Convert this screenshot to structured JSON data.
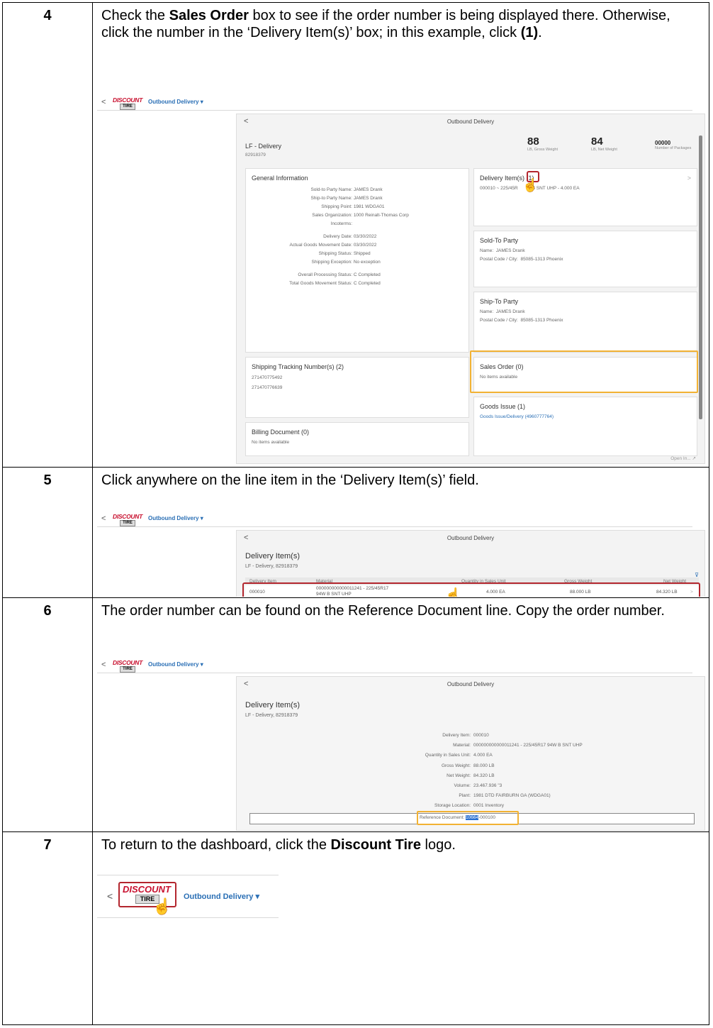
{
  "steps": [
    {
      "number": "4",
      "text_parts": [
        "Check the ",
        "Sales Order",
        " box to see if the order number is being displayed there. Otherwise, click the number in the ‘Delivery Item(s)’ box; in this example, click ",
        "(1)",
        "."
      ]
    },
    {
      "number": "5",
      "text": "Click anywhere on the line item in the ‘Delivery Item(s)’ field."
    },
    {
      "number": "6",
      "text": "The order number can be found on the Reference Document line. Copy the order number."
    },
    {
      "number": "7",
      "text_parts": [
        "To return to the dashboard, click the ",
        "Discount Tire",
        " logo."
      ]
    }
  ],
  "shell": {
    "back": "<",
    "logo_top": "DISCOUNT",
    "logo_bottom": "TIRE",
    "app_title": "Outbound Delivery ▾"
  },
  "s4": {
    "panel_title": "Outbound Delivery",
    "object_title": "LF - Delivery",
    "object_id": "82918379",
    "kpis": [
      {
        "value": "88",
        "label": "LB, Gross Weight"
      },
      {
        "value": "84",
        "label": "LB, Net Weight"
      },
      {
        "value": "00000",
        "label": "Number of Packages"
      }
    ],
    "general": {
      "title": "General Information",
      "rows": [
        {
          "k": "Sold-to Party Name:",
          "v": "JAMES Drank"
        },
        {
          "k": "Ship-to Party Name:",
          "v": "JAMES Drank"
        },
        {
          "k": "Shipping Point:",
          "v": "1981 WDGA01"
        },
        {
          "k": "Sales Organization:",
          "v": "1000 Reinalt-Thomas Corp"
        },
        {
          "k": "Incoterms:",
          "v": ""
        },
        {
          "k": "Delivery Date:",
          "v": "03/30/2022"
        },
        {
          "k": "Actual Goods Movement Date:",
          "v": "03/30/2022"
        },
        {
          "k": "Shipping Status:",
          "v": "Shipped"
        },
        {
          "k": "Shipping Exception:",
          "v": "No exception"
        },
        {
          "k": "Overall Processing Status:",
          "v": "C Completed"
        },
        {
          "k": "Total Goods Movement Status:",
          "v": "C Completed"
        }
      ]
    },
    "delivery_items": {
      "title": "Delivery Item(s)",
      "count": "(1)",
      "line": "000010 ~ 225/45R",
      "line_rest": "W B SNT UHP - 4.000 EA",
      "chevron": ">"
    },
    "sold_to": {
      "title": "Sold-To Party",
      "name_k": "Name:",
      "name_v": "JAMES Drank",
      "postal_k": "Postal Code / City:",
      "postal_v": "85085-1313 Phoenix"
    },
    "ship_to": {
      "title": "Ship-To Party",
      "name_k": "Name:",
      "name_v": "JAMES Drank",
      "postal_k": "Postal Code / City:",
      "postal_v": "85085-1313 Phoenix"
    },
    "tracking": {
      "title": "Shipping Tracking Number(s) (2)",
      "rows": [
        "271470775492",
        "271470776639"
      ]
    },
    "sales_order": {
      "title": "Sales Order (0)",
      "empty": "No items available"
    },
    "goods_issue": {
      "title": "Goods Issue (1)",
      "link": "Goods Issue/Delivery (4960777764)"
    },
    "billing": {
      "title": "Billing Document (0)",
      "empty": "No items available"
    },
    "footer": "Open In...  ↗"
  },
  "s5": {
    "panel_title": "Outbound Delivery",
    "title": "Delivery Item(s)",
    "subtitle": "LF - Delivery, 82918379",
    "filter": "⊽",
    "headers": [
      "Delivery Item",
      "Material",
      "Quantity in Sales Unit",
      "Gross Weight",
      "Net Weight"
    ],
    "row": {
      "item": "000010",
      "material1": "000000000000011241 - 225/45R17",
      "material2": "94W B SNT UHP",
      "qty": "4.000 EA",
      "gross": "88.000 LB",
      "net": "84.320 LB",
      "chevron": ">"
    }
  },
  "s6": {
    "panel_title": "Outbound Delivery",
    "title": "Delivery Item(s)",
    "subtitle": "LF - Delivery, 82918379",
    "rows": [
      {
        "k": "Delivery Item:",
        "v": "000010"
      },
      {
        "k": "Material:",
        "v": "000000000000011241 - 225/45R17 94W B SNT UHP"
      },
      {
        "k": "Quantity in Sales Unit:",
        "v": "4.000 EA"
      },
      {
        "k": "Gross Weight:",
        "v": "88.000 LB"
      },
      {
        "k": "Net Weight:",
        "v": "84.320 LB"
      },
      {
        "k": "Volume:",
        "v": "23.467.936 \"3"
      },
      {
        "k": "Plant:",
        "v": "1981 DTD FAIRBURN GA (WDGA01)"
      },
      {
        "k": "Storage Location:",
        "v": "0001 Inventory"
      }
    ],
    "ref_k": "Reference Document:",
    "ref_sel": "10664",
    "ref_rest": "-000100"
  },
  "s7": {
    "app_title": "Outbound Delivery ▾"
  }
}
